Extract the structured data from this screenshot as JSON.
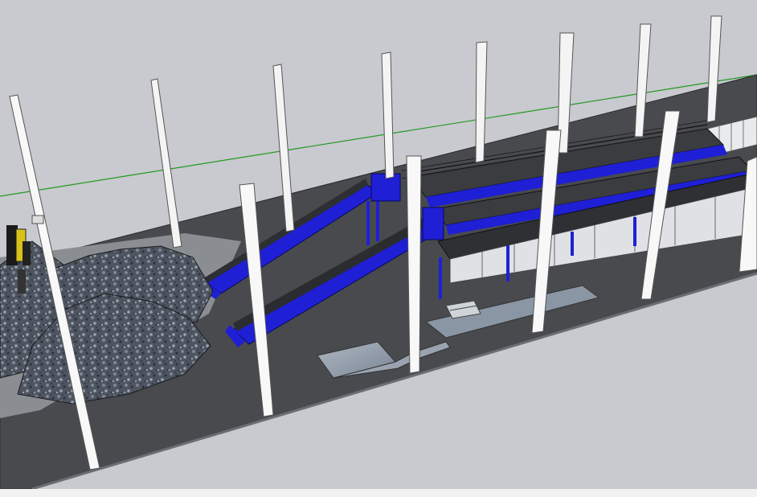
{
  "scene": {
    "background": "#c9c9d0",
    "floor_color": "#484a4e",
    "conveyor_color": "#1f1fd6",
    "column_color": "#f4f4f4",
    "axis_color": "#1f9a1f",
    "pile_color": "#5b6470",
    "bin_color": "#dfe1e4",
    "bottom_strip_color": "#f2f2f2"
  }
}
